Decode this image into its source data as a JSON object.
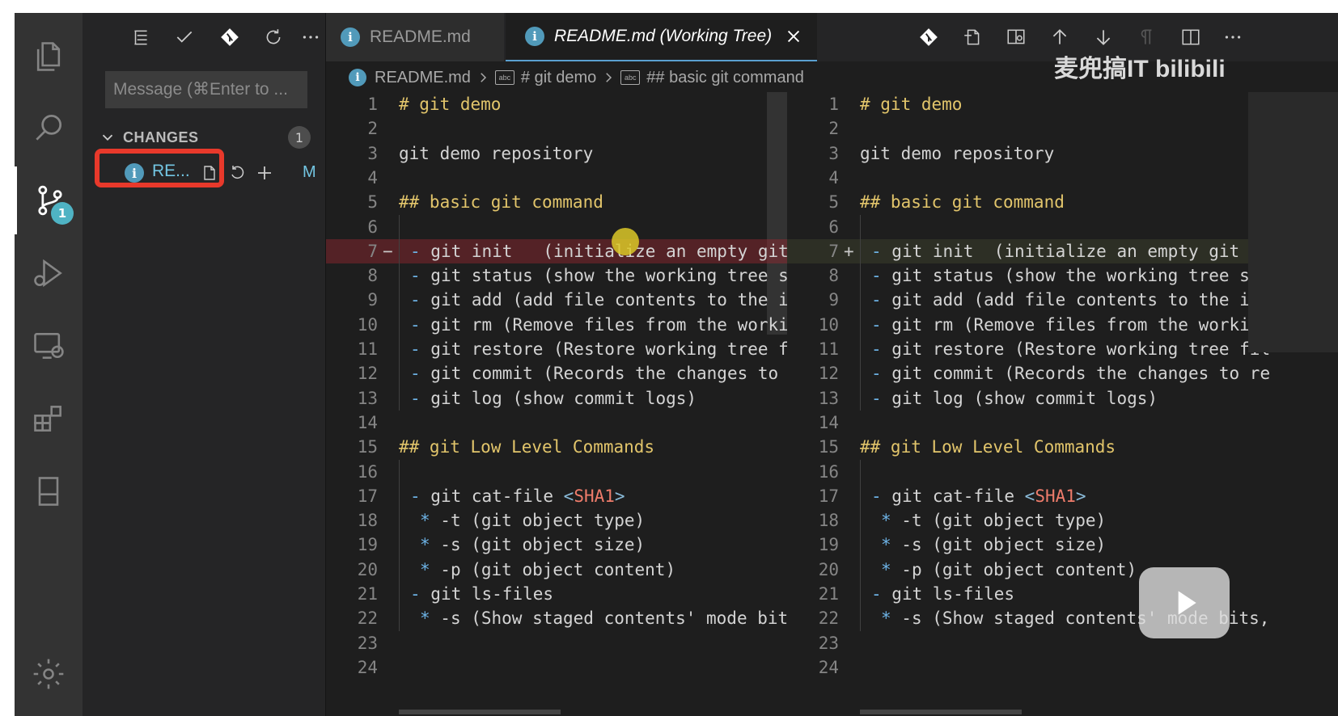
{
  "sidebar": {
    "commit_placeholder": "Message (⌘Enter to ...",
    "changes_title": "CHANGES",
    "changes_count": "1",
    "file": {
      "name": "RE...",
      "status": "M"
    }
  },
  "activity": {
    "scm_badge": "1"
  },
  "tabs": [
    {
      "label": "README.md"
    },
    {
      "label": "README.md (Working Tree)"
    }
  ],
  "breadcrumb": [
    "README.md",
    "# git demo",
    "## basic git command"
  ],
  "watermark": "麦兜搞IT bilibili",
  "left_lines": [
    {
      "n": "1",
      "t": "# git demo"
    },
    {
      "n": "2",
      "t": ""
    },
    {
      "n": "3",
      "t": "git demo repository"
    },
    {
      "n": "4",
      "t": ""
    },
    {
      "n": "5",
      "t": "## basic git command"
    },
    {
      "n": "6",
      "t": ""
    },
    {
      "n": "7",
      "t": "- git init   (initialize an empty git r"
    },
    {
      "n": "8",
      "t": "- git status (show the working tree sta"
    },
    {
      "n": "9",
      "t": "- git add (add file contents to the ind"
    },
    {
      "n": "10",
      "t": "- git rm (Remove files from the working"
    },
    {
      "n": "11",
      "t": "- git restore (Restore working tree fil"
    },
    {
      "n": "12",
      "t": "- git commit (Records the changes to re"
    },
    {
      "n": "13",
      "t": "- git log (show commit logs)"
    },
    {
      "n": "14",
      "t": ""
    },
    {
      "n": "15",
      "t": "## git Low Level Commands"
    },
    {
      "n": "16",
      "t": ""
    },
    {
      "n": "17",
      "t": "- git cat-file <SHA1>"
    },
    {
      "n": "18",
      "t": "* -t (git object type)"
    },
    {
      "n": "19",
      "t": "* -s (git object size)"
    },
    {
      "n": "20",
      "t": "* -p (git object content)"
    },
    {
      "n": "21",
      "t": "- git ls-files"
    },
    {
      "n": "22",
      "t": "* -s (Show staged contents' mode bits,"
    },
    {
      "n": "23",
      "t": ""
    },
    {
      "n": "24",
      "t": ""
    }
  ],
  "right_lines": [
    {
      "n": "1",
      "t": "# git demo"
    },
    {
      "n": "2",
      "t": ""
    },
    {
      "n": "3",
      "t": "git demo repository"
    },
    {
      "n": "4",
      "t": ""
    },
    {
      "n": "5",
      "t": "## basic git command"
    },
    {
      "n": "6",
      "t": ""
    },
    {
      "n": "7",
      "t": "- git init  (initialize an empty git re"
    },
    {
      "n": "8",
      "t": "- git status (show the working tree sta"
    },
    {
      "n": "9",
      "t": "- git add (add file contents to the ind"
    },
    {
      "n": "10",
      "t": "- git rm (Remove files from the working"
    },
    {
      "n": "11",
      "t": "- git restore (Restore working tree fil"
    },
    {
      "n": "12",
      "t": "- git commit (Records the changes to re"
    },
    {
      "n": "13",
      "t": "- git log (show commit logs)"
    },
    {
      "n": "14",
      "t": ""
    },
    {
      "n": "15",
      "t": "## git Low Level Commands"
    },
    {
      "n": "16",
      "t": ""
    },
    {
      "n": "17",
      "t": "- git cat-file <SHA1>"
    },
    {
      "n": "18",
      "t": "* -t (git object type)"
    },
    {
      "n": "19",
      "t": "* -s (git object size)"
    },
    {
      "n": "20",
      "t": "* -p (git object content)"
    },
    {
      "n": "21",
      "t": "- git ls-files"
    },
    {
      "n": "22",
      "t": "* -s (Show staged contents' mode bits,"
    },
    {
      "n": "23",
      "t": ""
    },
    {
      "n": "24",
      "t": ""
    }
  ],
  "colors": {
    "accent": "#4fb3c4",
    "highlight": "#e8392b",
    "heading": "#e2c56b"
  }
}
